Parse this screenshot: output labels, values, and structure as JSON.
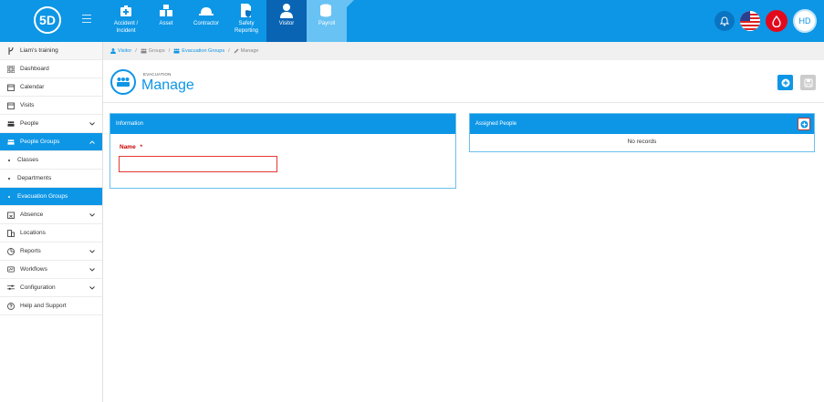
{
  "topbar": {
    "logo_text": "5D",
    "modules": [
      {
        "label": "Accident / Incident",
        "icon": "first-aid-icon"
      },
      {
        "label": "Asset",
        "icon": "boxes-icon"
      },
      {
        "label": "Contractor",
        "icon": "hardhat-icon"
      },
      {
        "label": "Safety Reporting",
        "icon": "safety-report-icon"
      },
      {
        "label": "Visitor",
        "icon": "person-icon"
      },
      {
        "label": "Payroll",
        "icon": "coins-icon"
      }
    ],
    "avatar_initials": "HD"
  },
  "sidebar": {
    "items": [
      {
        "label": "Liam's training"
      },
      {
        "label": "Dashboard"
      },
      {
        "label": "Calendar"
      },
      {
        "label": "Visits"
      },
      {
        "label": "People"
      },
      {
        "label": "People Groups"
      },
      {
        "label": "Classes"
      },
      {
        "label": "Departments"
      },
      {
        "label": "Evacuation Groups"
      },
      {
        "label": "Absence"
      },
      {
        "label": "Locations"
      },
      {
        "label": "Reports"
      },
      {
        "label": "Workflows"
      },
      {
        "label": "Configuration"
      },
      {
        "label": "Help and Support"
      }
    ]
  },
  "breadcrumb": {
    "items": [
      "Visitor",
      "Groups",
      "Evacuation Groups",
      "Manage"
    ],
    "separator": "/"
  },
  "header": {
    "subtitle": "EVACUATION",
    "title": "Manage"
  },
  "information": {
    "title": "Information",
    "name_label": "Name",
    "required_mark": "*",
    "name_value": ""
  },
  "assigned": {
    "title": "Assigned People",
    "empty_text": "No records"
  },
  "colors": {
    "primary": "#0d96e6",
    "active_module": "#0a64b4",
    "alert": "#e3091c"
  }
}
